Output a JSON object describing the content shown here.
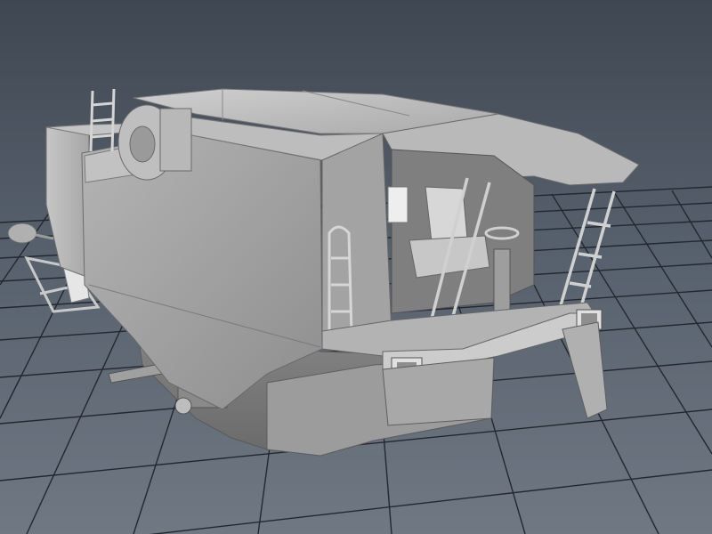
{
  "viewport": {
    "camera": "perspective",
    "display_mode": "smooth-shaded",
    "grid": true,
    "background_top": "#3f4752",
    "background_bottom": "#6f7883",
    "grid_color": "#222831",
    "model_color": "#a9a9a9"
  },
  "scene": {
    "object": "harvester-cab-model",
    "parts": [
      "main-body",
      "rear-tank",
      "roof",
      "cab-canopy",
      "cab-interior",
      "operator-seat",
      "steering-column",
      "front-ladder",
      "side-handrail",
      "top-ladder",
      "drive-wheel-hub",
      "undercarriage",
      "front-bumper",
      "headlight-left",
      "headlight-right",
      "header-arm",
      "side-mirror"
    ]
  }
}
